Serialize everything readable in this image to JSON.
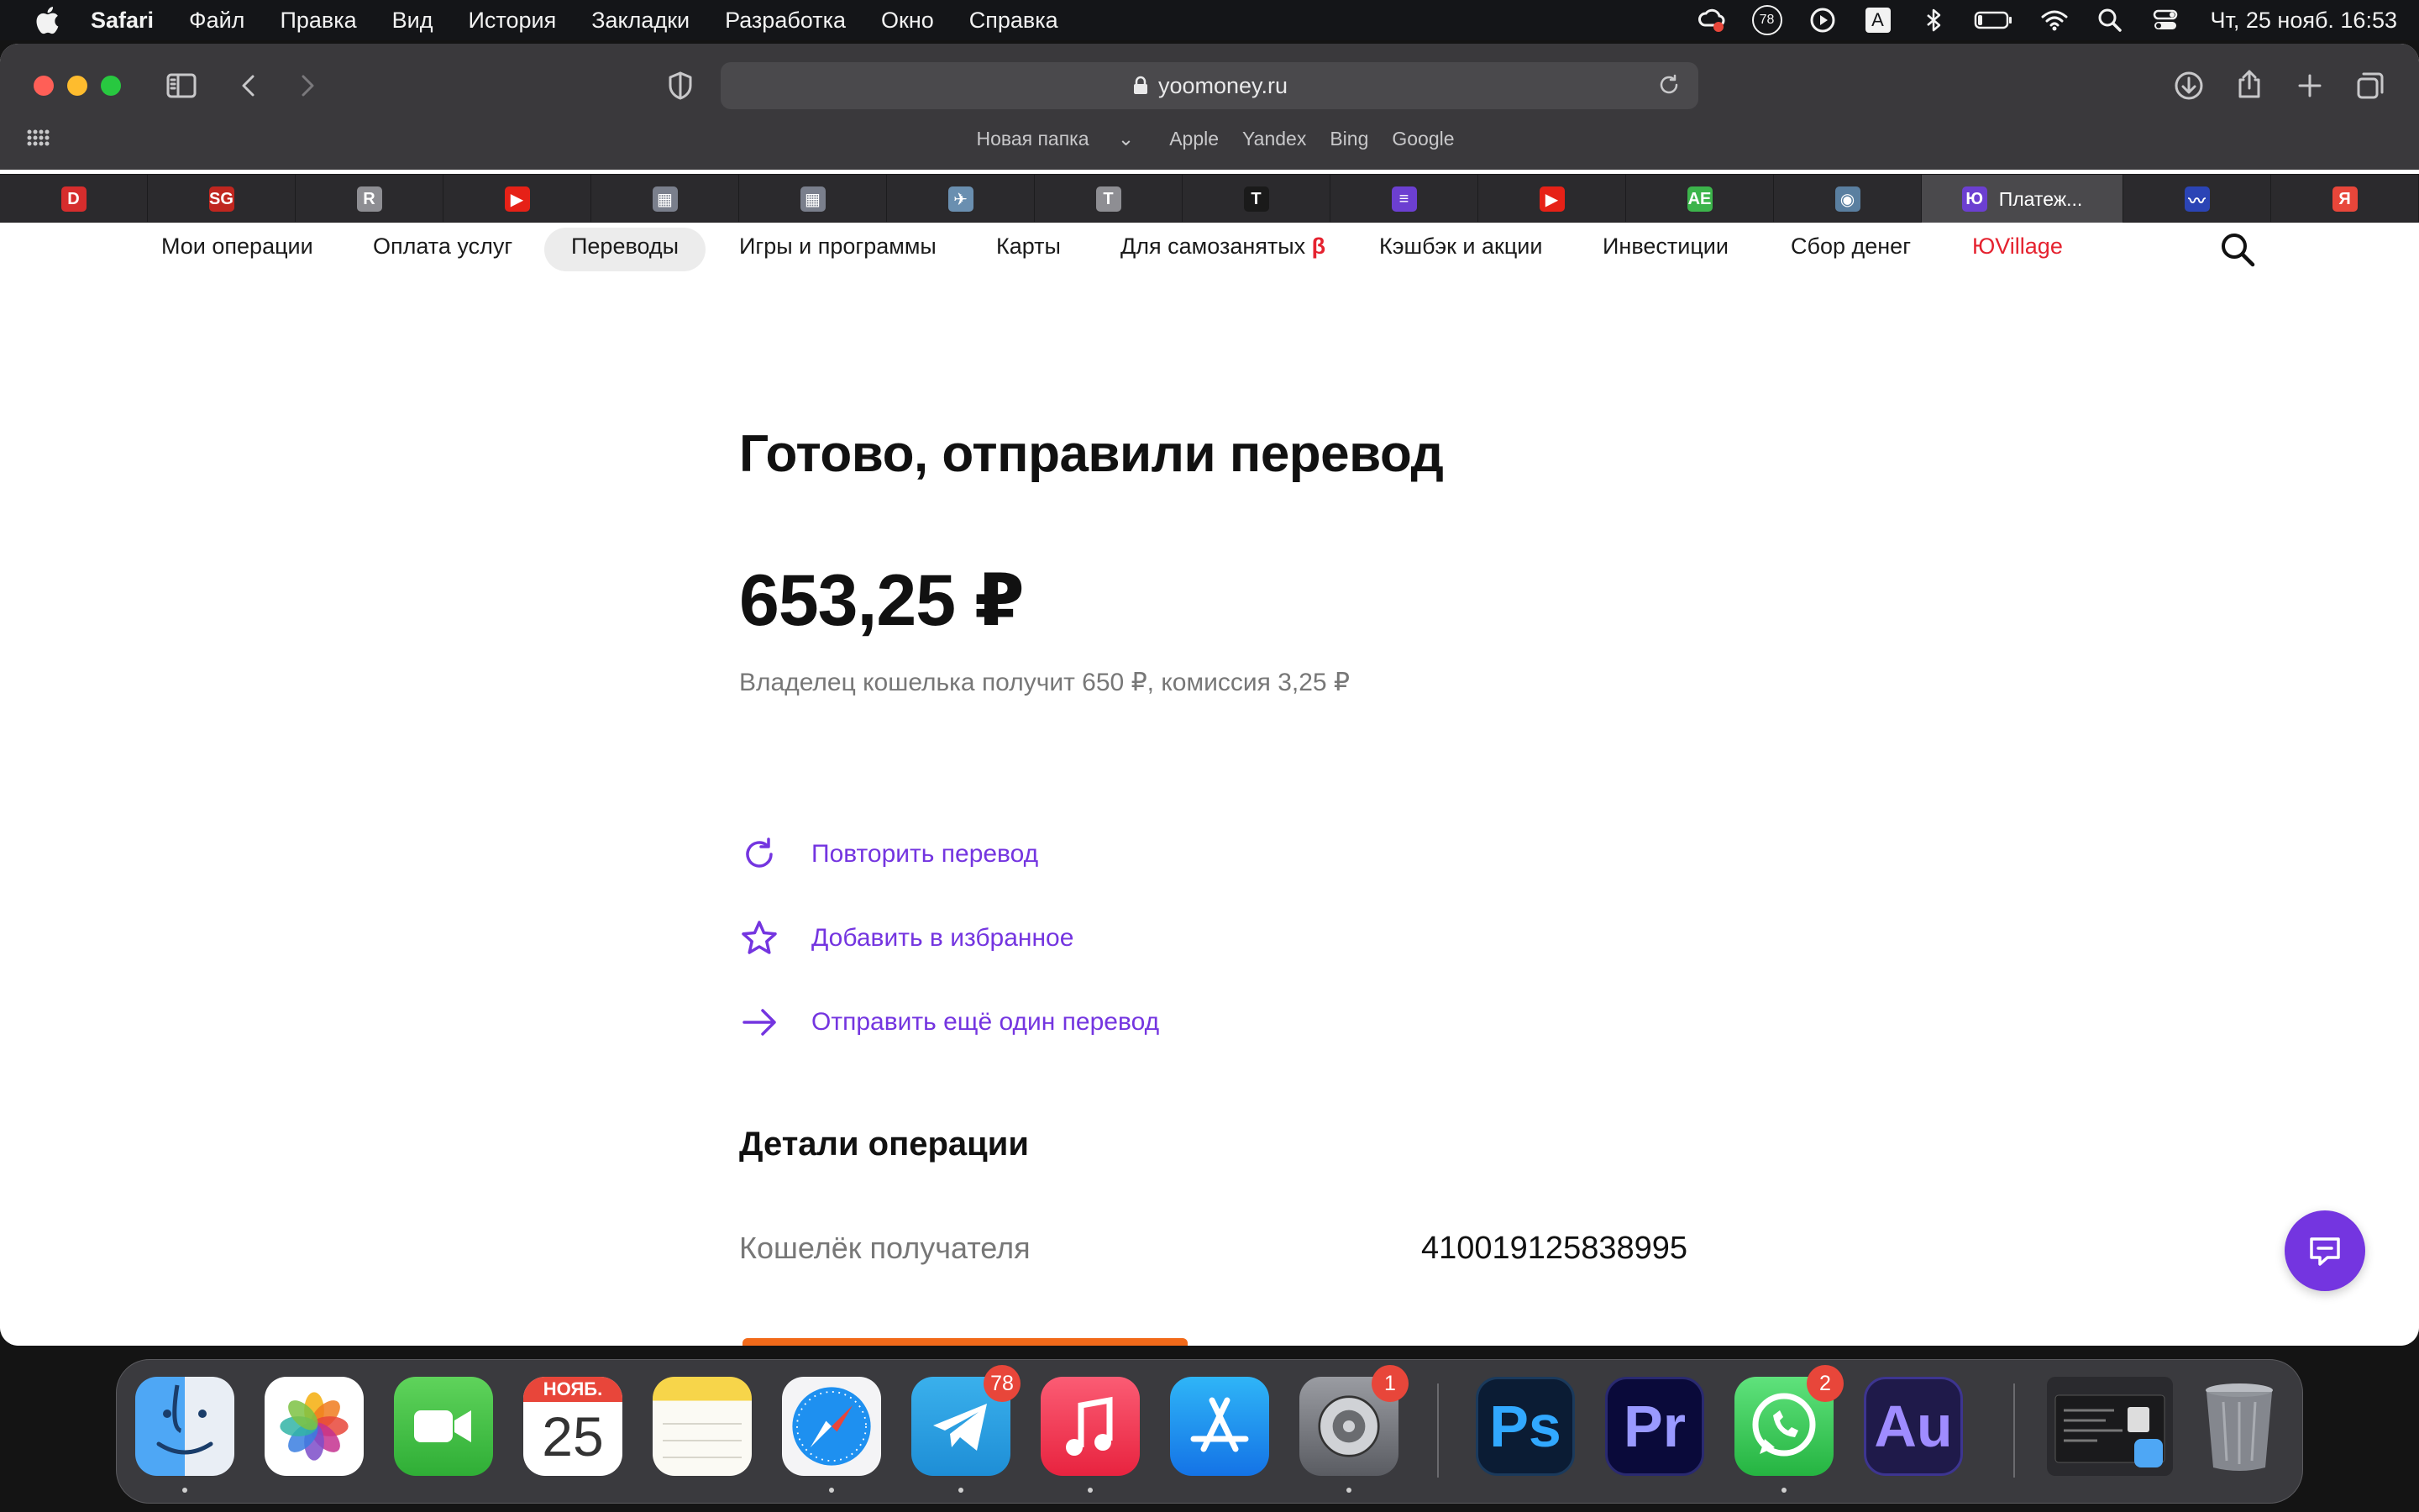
{
  "menubar": {
    "app": "Safari",
    "items": [
      "Файл",
      "Правка",
      "Вид",
      "История",
      "Закладки",
      "Разработка",
      "Окно",
      "Справка"
    ],
    "notification_count": "78",
    "input_source": "A",
    "clock": "Чт, 25 нояб.  16:53"
  },
  "safari": {
    "url": "yoomoney.ru",
    "bookmarks": [
      "Новая папка",
      "Apple",
      "Yandex",
      "Bing",
      "Google"
    ],
    "tabs": [
      {
        "icon": "D",
        "color": "#d62d2d"
      },
      {
        "icon": "SG",
        "color": "#c0261f"
      },
      {
        "icon": "R",
        "color": "#8e8e93"
      },
      {
        "icon": "▶",
        "color": "#e62117"
      },
      {
        "icon": "▦",
        "color": "#7a7f8c"
      },
      {
        "icon": "▦",
        "color": "#7a7f8c"
      },
      {
        "icon": "✈",
        "color": "#6a8fb0"
      },
      {
        "icon": "T",
        "color": "#8e8e93"
      },
      {
        "icon": "T",
        "color": "#1a1a1a"
      },
      {
        "icon": "≡",
        "color": "#6c3fd1"
      },
      {
        "icon": "▶",
        "color": "#e62117"
      },
      {
        "icon": "AE",
        "color": "#3cb44b"
      },
      {
        "icon": "◉",
        "color": "#5a7fa0"
      },
      {
        "icon": "Ю",
        "color": "#6c3fd1",
        "label": "Платеж...",
        "active": true
      },
      {
        "icon": "〰",
        "color": "#2b44b5"
      },
      {
        "icon": "Я",
        "color": "#e8463a"
      }
    ]
  },
  "site": {
    "nav": [
      "Мои операции",
      "Оплата услуг",
      "Переводы",
      "Игры и программы",
      "Карты",
      "Для самозанятых",
      "Кэшбэк и акции",
      "Инвестиции",
      "Сбор денег",
      "ЮVillage"
    ],
    "beta": "β",
    "active_nav": "Переводы",
    "accent_color": "#7435e0"
  },
  "result": {
    "title": "Готово, отправили перевод",
    "amount": "653,25 ₽",
    "subinfo": "Владелец кошелька получит 650 ₽, комиссия 3,25 ₽",
    "actions": [
      "Повторить перевод",
      "Добавить в избранное",
      "Отправить ещё один перевод"
    ],
    "details_title": "Детали операции",
    "wallet_label": "Кошелёк получателя",
    "wallet_value": "410019125838995"
  },
  "dock": {
    "calendar_month": "НОЯБ.",
    "calendar_day": "25",
    "badges": {
      "telegram": "78",
      "settings": "1",
      "whatsapp": "2"
    },
    "apps": {
      "photoshop": "Ps",
      "premiere": "Pr",
      "audition": "Au"
    }
  }
}
